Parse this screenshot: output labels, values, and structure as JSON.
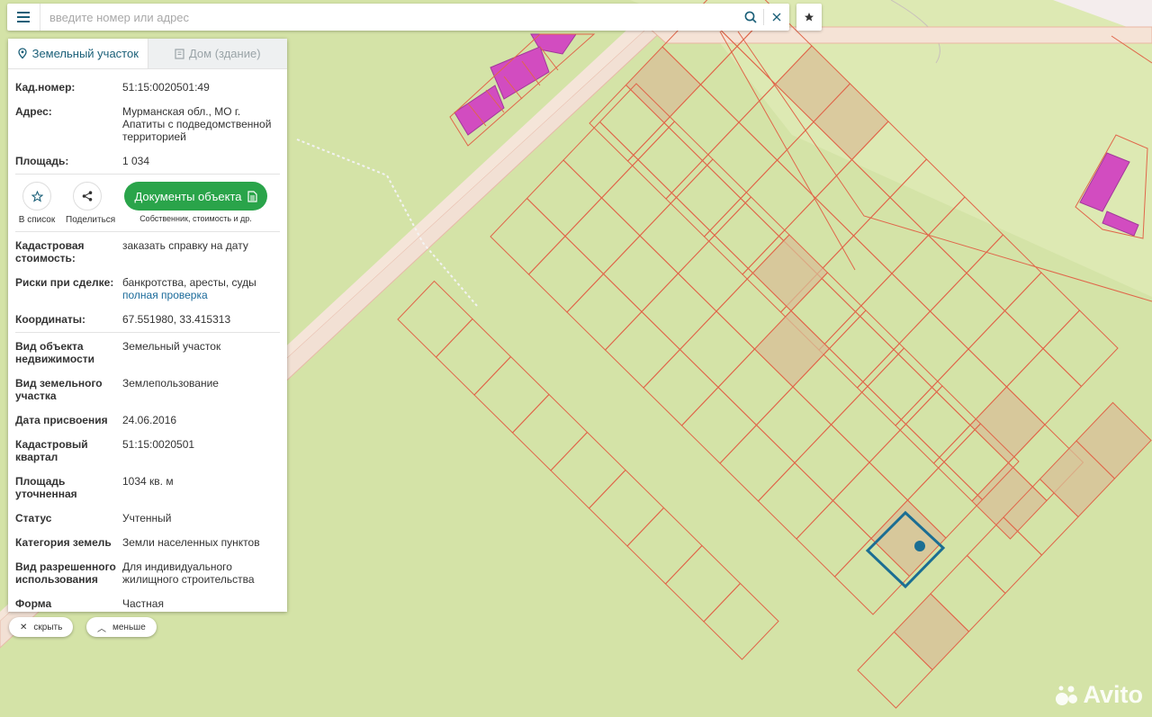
{
  "search": {
    "placeholder": "введите номер или адрес"
  },
  "tabs": [
    {
      "label": "Земельный участок",
      "active": true
    },
    {
      "label": "Дом (здание)",
      "active": false
    }
  ],
  "info_top": [
    {
      "label": "Кад.номер:",
      "value": "51:15:0020501:49",
      "link": true
    },
    {
      "label": "Адрес:",
      "value": "Мурманская обл., МО г. Апатиты с подведомственной территорией"
    },
    {
      "label": "Площадь:",
      "value": "1 034"
    }
  ],
  "actions": {
    "favorite_label": "В список",
    "share_label": "Поделиться",
    "docs_label": "Документы объекта",
    "docs_sub": "Собственник, стоимость и др."
  },
  "info_mid": {
    "cost_label": "Кадастровая стоимость:",
    "cost_link": "заказать справку на дату",
    "risks_label": "Риски при сделке:",
    "risks_value": "банкротства, аресты, суды",
    "risks_link": "полная проверка",
    "coords_label": "Координаты:",
    "coords_value": "67.551980, 33.415313"
  },
  "info_bottom": [
    {
      "label": "Вид объекта недвижимости",
      "value": "Земельный участок"
    },
    {
      "label": "Вид земельного участка",
      "value": "Землепользование"
    },
    {
      "label": "Дата присвоения",
      "value": "24.06.2016"
    },
    {
      "label": "Кадастровый квартал",
      "value": "51:15:0020501"
    },
    {
      "label": "Площадь уточненная",
      "value": "1034 кв. м"
    },
    {
      "label": "Статус",
      "value": "Учтенный"
    },
    {
      "label": "Категория земель",
      "value": "Земли населенных пунктов"
    },
    {
      "label": "Вид разрешенного использования",
      "value": "Для индивидуального жилищного строительства"
    },
    {
      "label": "Форма собственности",
      "value": "Частная"
    }
  ],
  "controls": {
    "hide_label": "скрыть",
    "less_label": "меньше"
  },
  "watermark": "Avito",
  "colors": {
    "map_bg": "#d4e3a7",
    "parcel_stroke": "#e0664a",
    "parcel_fill": "#d8bf97",
    "road": "#f0dcd0",
    "building": "#d24cc0",
    "selection": "#1b6e93",
    "accent": "#1a5f78",
    "docs_button": "#2aa44a"
  }
}
